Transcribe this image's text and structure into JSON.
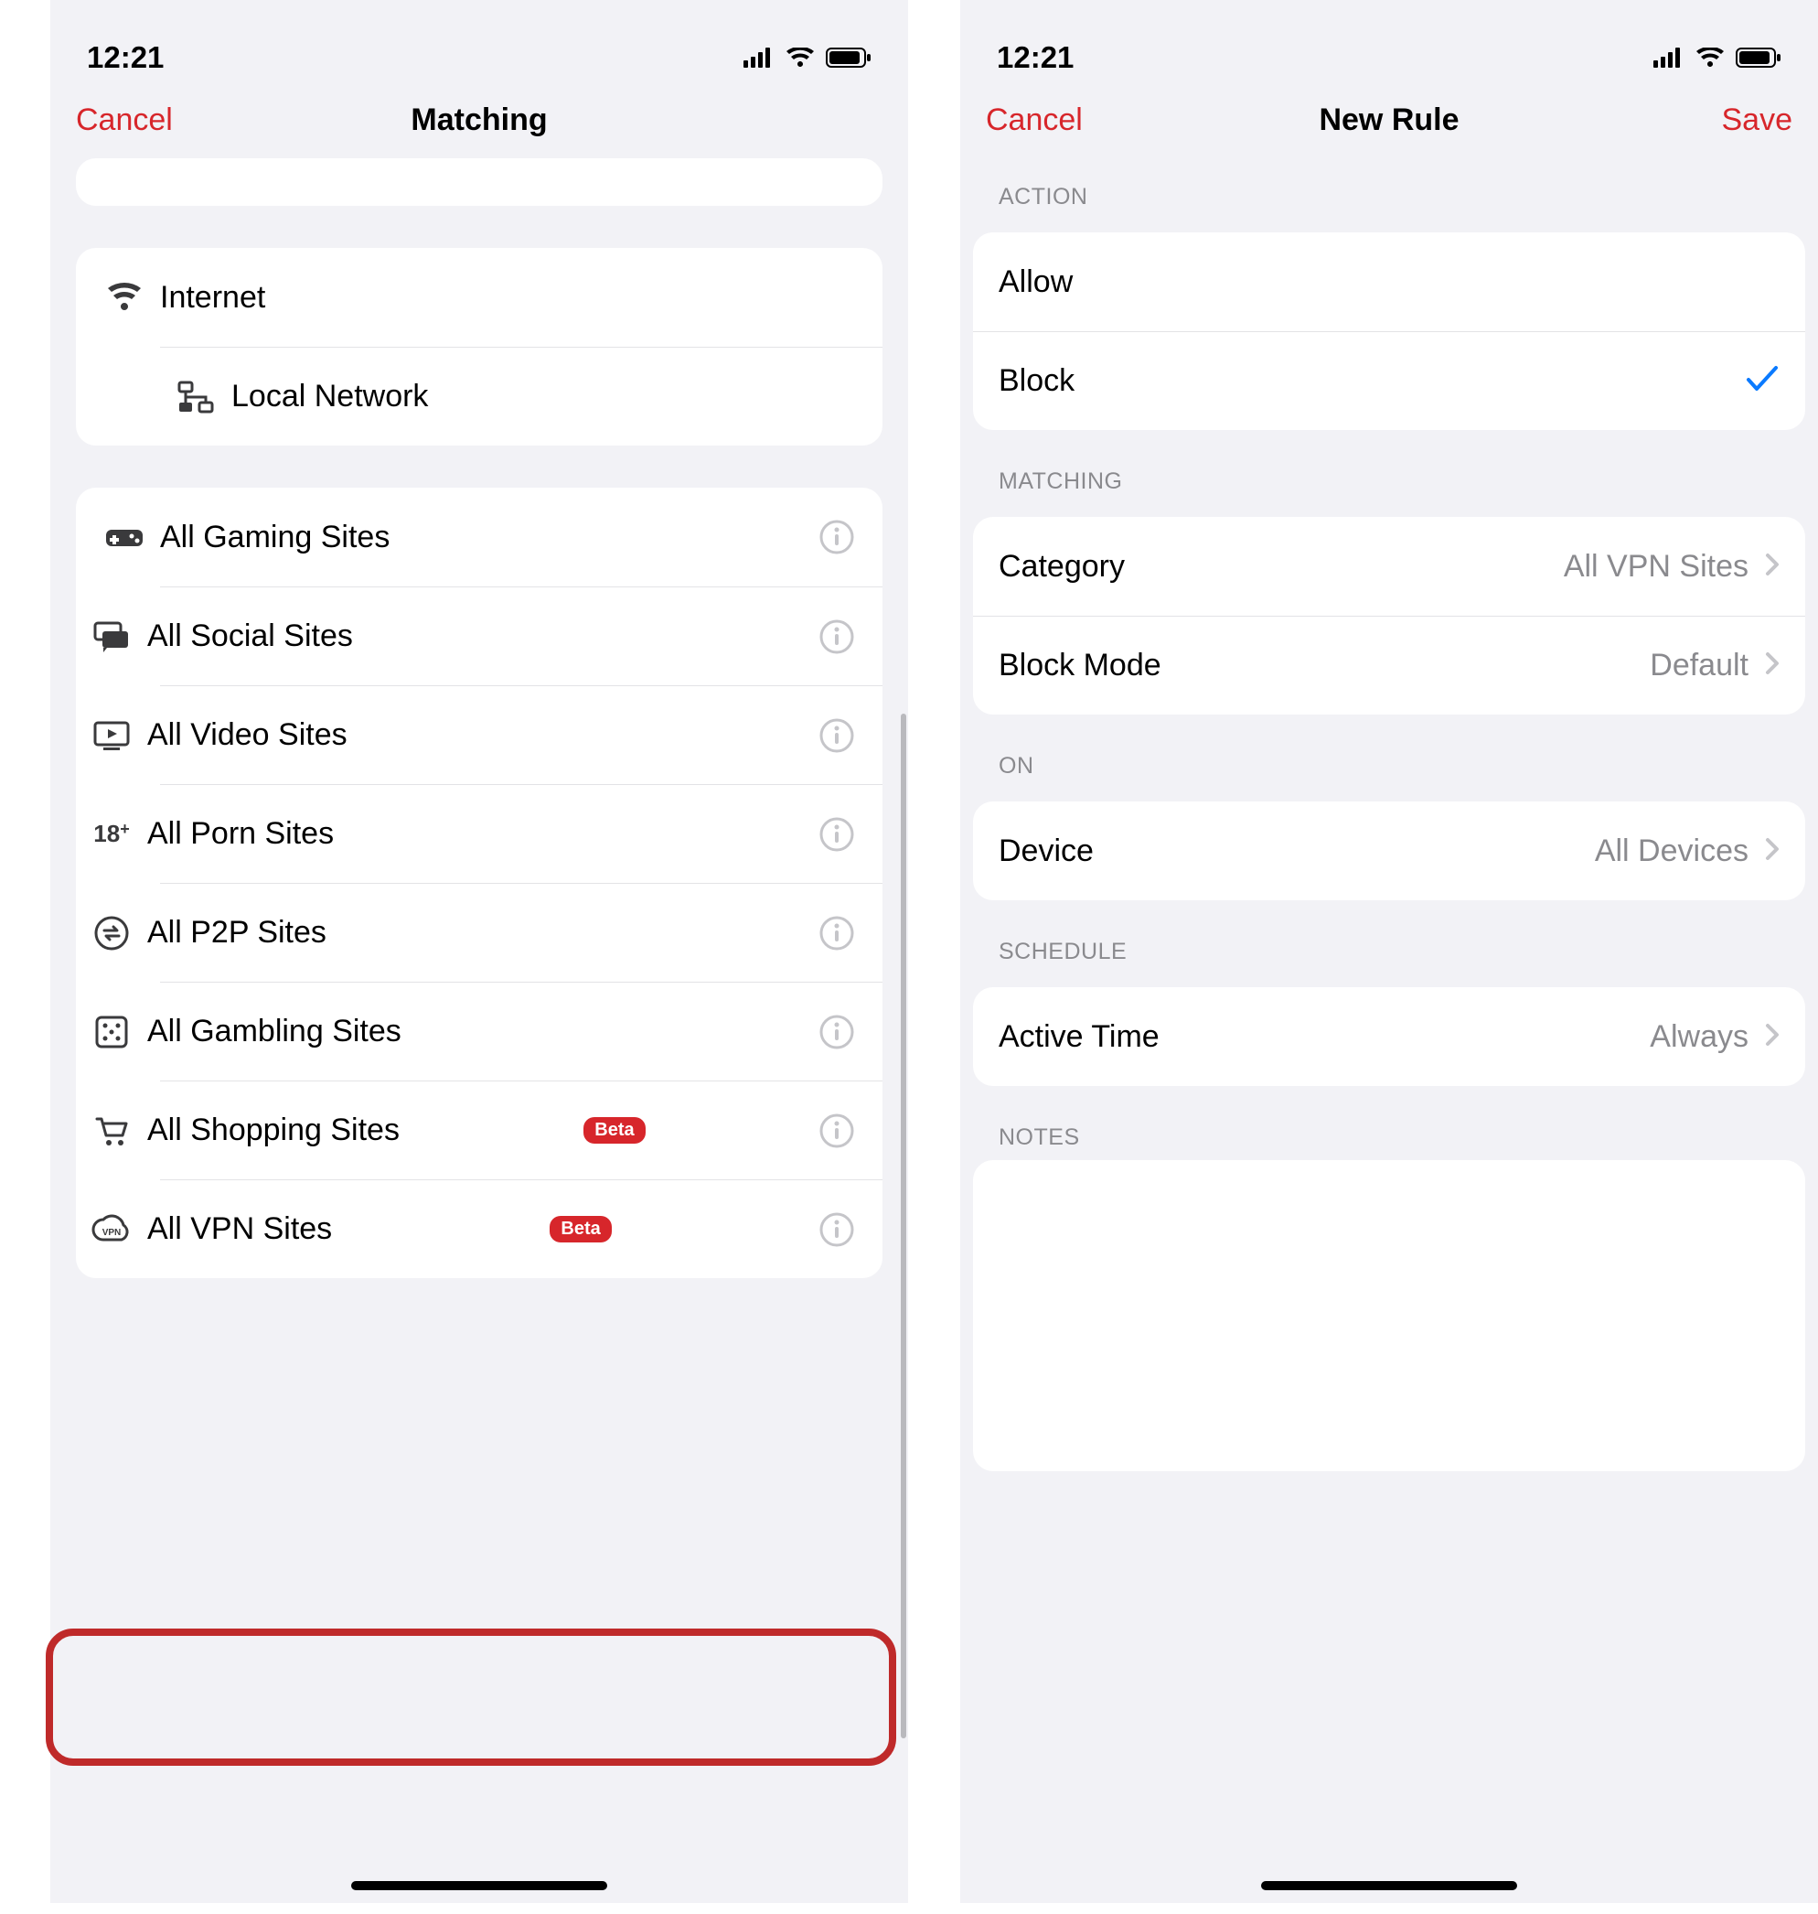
{
  "status": {
    "time": "12:21"
  },
  "left": {
    "nav": {
      "cancel": "Cancel",
      "title": "Matching"
    },
    "group1": [
      {
        "icon": "wifi-icon",
        "label": "Internet"
      },
      {
        "icon": "network-icon",
        "label": "Local Network"
      }
    ],
    "group2": [
      {
        "icon": "gamepad-icon",
        "label": "All Gaming Sites",
        "info": true
      },
      {
        "icon": "chat-icon",
        "label": "All Social Sites",
        "info": true
      },
      {
        "icon": "video-icon",
        "label": "All Video Sites",
        "info": true
      },
      {
        "icon": "18plus-icon",
        "label": "All Porn Sites",
        "info": true
      },
      {
        "icon": "swap-icon",
        "label": "All P2P Sites",
        "info": true
      },
      {
        "icon": "dice-icon",
        "label": "All Gambling Sites",
        "info": true
      },
      {
        "icon": "cart-icon",
        "label": "All Shopping Sites",
        "info": true,
        "badge": "Beta"
      },
      {
        "icon": "vpn-icon",
        "label": "All VPN Sites",
        "info": true,
        "badge": "Beta"
      }
    ]
  },
  "right": {
    "nav": {
      "cancel": "Cancel",
      "title": "New Rule",
      "save": "Save"
    },
    "sections": {
      "action": {
        "header": "ACTION",
        "allow": "Allow",
        "block": "Block",
        "selected": "block"
      },
      "matching": {
        "header": "MATCHING",
        "category_k": "Category",
        "category_v": "All VPN Sites",
        "mode_k": "Block Mode",
        "mode_v": "Default"
      },
      "on": {
        "header": "ON",
        "device_k": "Device",
        "device_v": "All Devices"
      },
      "schedule": {
        "header": "SCHEDULE",
        "active_k": "Active Time",
        "active_v": "Always"
      },
      "notes": {
        "header": "NOTES"
      }
    }
  }
}
